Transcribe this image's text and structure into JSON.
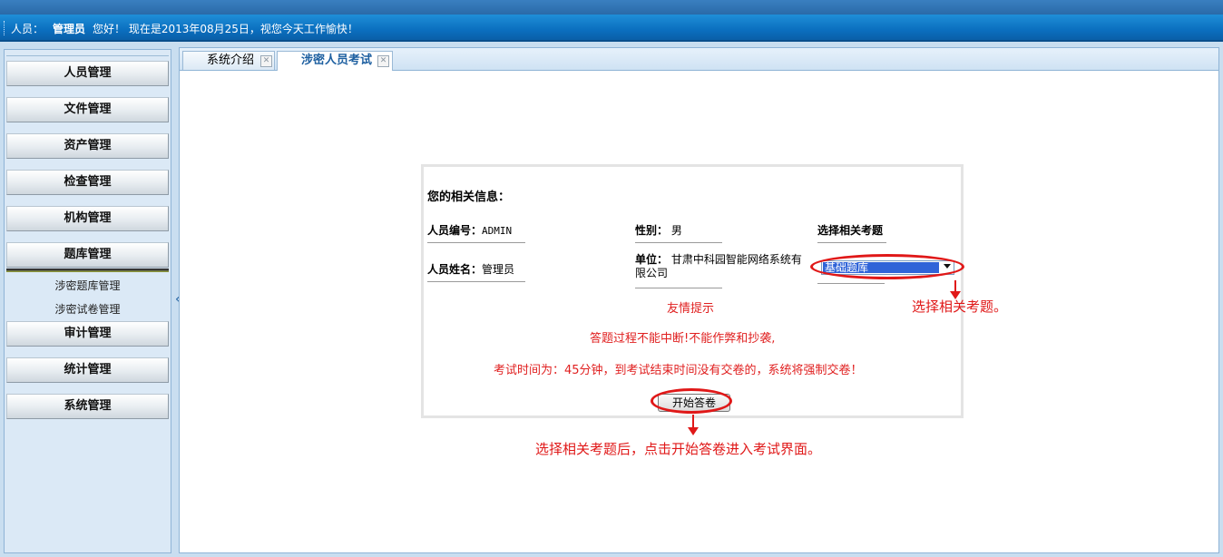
{
  "header": {
    "user_label": "人员：",
    "user_role": "管理员",
    "greeting": "您好！  现在是2013年08月25日，视您今天工作愉快！"
  },
  "sidebar": {
    "menu": [
      {
        "label": "人员管理"
      },
      {
        "label": "文件管理"
      },
      {
        "label": "资产管理"
      },
      {
        "label": "检查管理"
      },
      {
        "label": "机构管理"
      },
      {
        "label": "题库管理"
      },
      {
        "label": "审计管理"
      },
      {
        "label": "统计管理"
      },
      {
        "label": "系统管理"
      }
    ],
    "sub_items": [
      {
        "label": "涉密题库管理"
      },
      {
        "label": "涉密试卷管理"
      }
    ],
    "collapse_glyph": "«"
  },
  "tabs": [
    {
      "label": "系统介绍",
      "active": false
    },
    {
      "label": "涉密人员考试",
      "active": true
    }
  ],
  "exam": {
    "info_heading": "您的相关信息：",
    "id_label": "人员编号：",
    "id_value": "ADMIN",
    "name_label": "人员姓名：",
    "name_value": "管理员",
    "gender_label": "性别：",
    "gender_value": "男",
    "unit_label": "单位：",
    "unit_value_line1": "甘肃中科园智能网络系统有",
    "unit_value_line2": "限公司",
    "select_heading": "选择相关考题",
    "select_value": "基础题库",
    "tip_title": "友情提示",
    "tip_line1": "答题过程不能中断!不能作弊和抄袭,",
    "tip_line2": "考试时间为：45分钟，到考试结束时间没有交卷的，系统将强制交卷！",
    "start_button": "开始答卷"
  },
  "annotations": {
    "select_note": "选择相关考题。",
    "start_note": "选择相关考题后，点击开始答卷进入考试界面。",
    "color": "#e01818"
  },
  "colors": {
    "header_blue": "#0b6fbf",
    "sidebar_bg": "#dbe9f6",
    "active_tab_text": "#1d5fa0",
    "tip_red": "#e02020"
  }
}
